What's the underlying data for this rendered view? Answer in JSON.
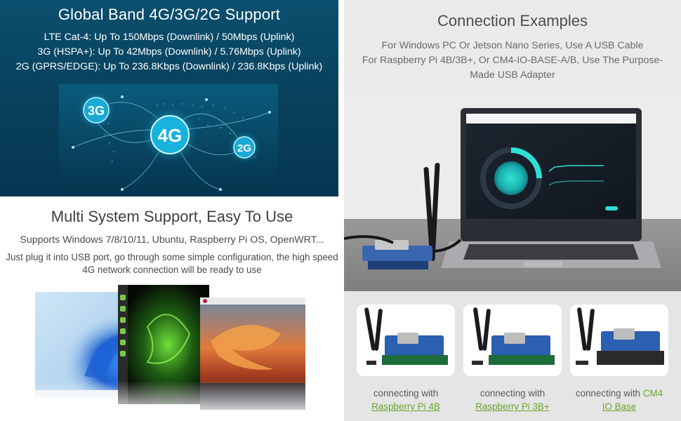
{
  "band_panel": {
    "title": "Global Band 4G/3G/2G Support",
    "specs": [
      "LTE Cat-4: Up To 150Mbps (Downlink) / 50Mbps (Uplink)",
      "3G (HSPA+): Up To 42Mbps (Downlink) / 5.76Mbps (Uplink)",
      "2G (GPRS/EDGE): Up To 236.8Kbps (Downlink) / 236.8Kbps (Uplink)"
    ],
    "badges": {
      "b3g": "3G",
      "b4g": "4G",
      "b2g": "2G"
    }
  },
  "multi_system": {
    "title": "Multi System Support, Easy To Use",
    "systems": "Supports Windows 7/8/10/11, Ubuntu, Raspberry Pi OS, OpenWRT...",
    "plug_line1": "Just plug it into USB port, go through some simple configuration, the high speed",
    "plug_line2": "4G network connection will be ready to use"
  },
  "connection": {
    "title": "Connection Examples",
    "line1": "For Windows PC Or Jetson Nano Series, Use A USB Cable",
    "line2": "For Raspberry Pi 4B/3B+, Or CM4-IO-BASE-A/B, Use The Purpose-",
    "line3": "Made USB Adapter"
  },
  "cards": [
    {
      "prefix": "connecting with",
      "link": "Raspberry Pi 4B"
    },
    {
      "prefix": "connecting with",
      "link": "Raspberry Pi 3B+"
    },
    {
      "prefix": "connecting with",
      "link_inline": "CM4",
      "link_line2": "IO Base"
    }
  ],
  "colors": {
    "band_bg": "#08405b",
    "link_green": "#6aa52e",
    "section_gray": "#eaeaea",
    "glow_cyan": "#27c8e8"
  }
}
